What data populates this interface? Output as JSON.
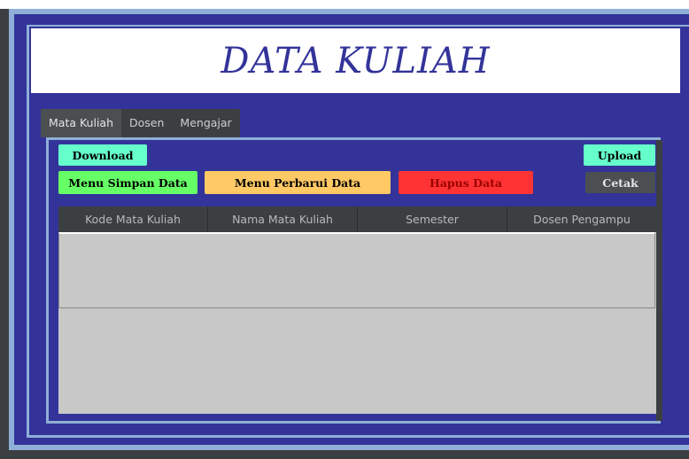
{
  "title": "DATA KULIAH",
  "tabs": [
    {
      "label": "Mata Kuliah",
      "active": true
    },
    {
      "label": "Dosen",
      "active": false
    },
    {
      "label": "Mengajar",
      "active": false
    }
  ],
  "buttons": {
    "download": "Download",
    "upload": "Upload",
    "simpan": "Menu Simpan Data",
    "perbarui": "Menu Perbarui Data",
    "hapus": "Hapus Data",
    "cetak": "Cetak"
  },
  "table": {
    "columns": [
      "Kode Mata Kuliah",
      "Nama Mata Kuliah",
      "Semester",
      "Dosen Pengampu"
    ],
    "rows": []
  },
  "colors": {
    "primary_blue": "#33339a",
    "frame_light": "#8fafd8",
    "dark_gray": "#3c3f41",
    "download_upload": "#66ffcc",
    "simpan": "#66ff66",
    "perbarui": "#ffc966",
    "hapus": "#ff3333",
    "cetak": "#4b4f51"
  }
}
